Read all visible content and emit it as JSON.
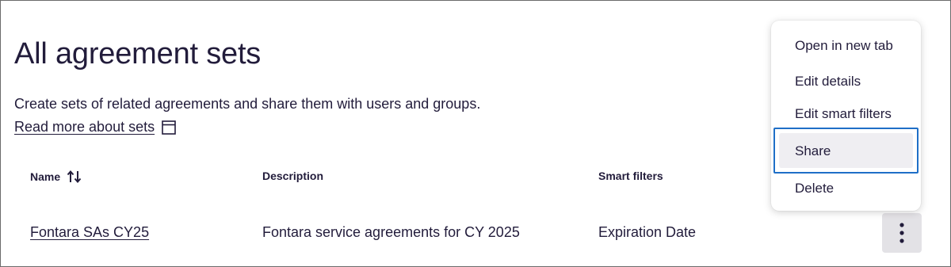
{
  "page": {
    "title": "All agreement sets",
    "description": "Create sets of related agreements and share them with users and groups.",
    "read_more": "Read more about sets"
  },
  "table": {
    "columns": [
      "Name",
      "Description",
      "Smart filters"
    ],
    "rows": [
      {
        "name": "Fontara SAs CY25",
        "description": "Fontara service agreements for CY 2025",
        "smart_filters": "Expiration Date"
      }
    ]
  },
  "menu": {
    "items": [
      "Open in new tab",
      "Edit details",
      "Edit smart filters",
      "Share",
      "Delete"
    ],
    "focused_item": "Share"
  },
  "colors": {
    "text": "#221c3b",
    "focus_ring": "#1f6fc7",
    "kebab_bg": "#e3e2e6",
    "hover_bg": "#efeef2"
  },
  "icons": {
    "read_more": "external-window-icon",
    "name_sort": "sort-icon",
    "row_actions": "more-vertical-icon"
  }
}
